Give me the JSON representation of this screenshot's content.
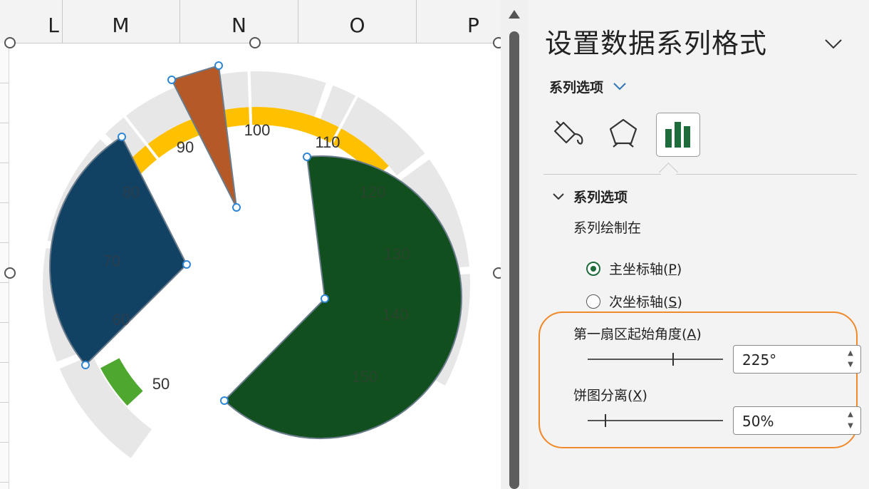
{
  "columns": [
    "L",
    "M",
    "N",
    "O",
    "P"
  ],
  "chart": {
    "scale_labels": [
      "50",
      "60",
      "70",
      "80",
      "90",
      "100",
      "110",
      "120",
      "130",
      "140",
      "150"
    ],
    "colors": {
      "outer_track": "#e7e7e7",
      "gold_ring": "#ffc000",
      "green_ring": "#4ea72e",
      "navy_slice": "#124263",
      "orange_slice": "#b55a26",
      "dark_green_slice": "#124f1e",
      "selection_handle": "#2e86d6"
    }
  },
  "pane": {
    "title": "设置数据系列格式",
    "series_options_dropdown": "系列选项",
    "tabs": [
      "fill-line-icon",
      "effects-pentagon-icon",
      "series-options-bar-icon"
    ],
    "section_title": "系列选项",
    "plot_on_label": "系列绘制在",
    "primary_axis": {
      "text": "主坐标轴(",
      "key": "P",
      "end": ")",
      "selected": true
    },
    "secondary_axis": {
      "text": "次坐标轴(",
      "key": "S",
      "end": ")",
      "selected": false
    },
    "first_slice_angle": {
      "text": "第一扇区起始角度(",
      "key": "A",
      "end": ")",
      "value": "225°",
      "slider_fraction": 0.625
    },
    "pie_explosion": {
      "text": "饼图分离(",
      "key": "X",
      "end": ")",
      "value": "50%",
      "slider_fraction": 0.125
    },
    "highlight_color": "#f0892a",
    "radio_color": "#1e6b3c"
  }
}
